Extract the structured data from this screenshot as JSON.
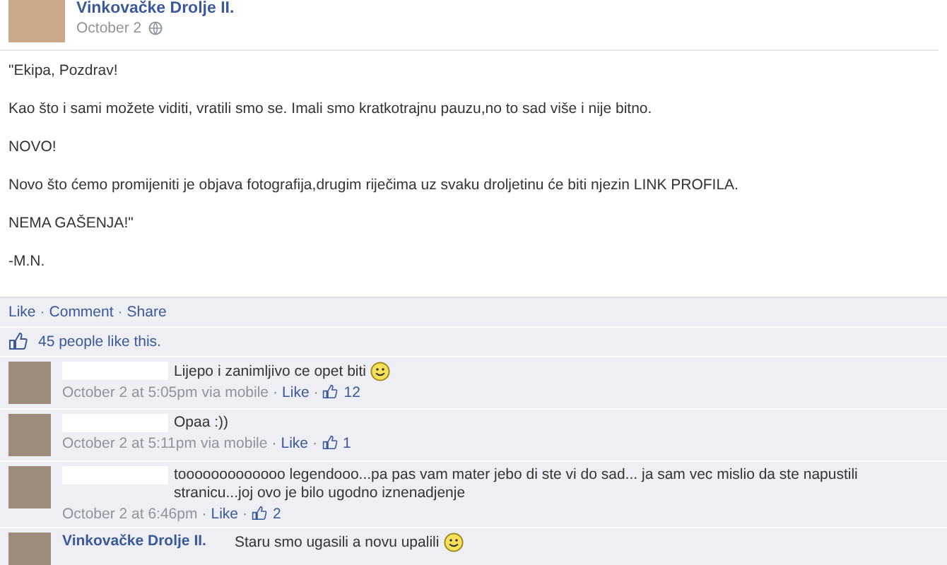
{
  "post": {
    "author": "Vinkovačke Drolje II.",
    "date": "October 2",
    "paragraphs": [
      "\"Ekipa, Pozdrav!",
      "Kao što i sami možete viditi, vratili smo se. Imali smo kratkotrajnu pauzu,no to sad više i nije bitno.",
      "NOVO!",
      "Novo što ćemo promijeniti je objava fotografija,drugim riječima uz svaku droljetinu će biti njezin LINK PROFILA.",
      "NEMA GAŠENJA!\"",
      "-M.N."
    ]
  },
  "separator": "·",
  "actions": [
    "Like",
    "Comment",
    "Share"
  ],
  "likes": "45 people like this.",
  "comments": [
    {
      "text": "Lijepo i zanimljivo ce opet biti",
      "smiley": true,
      "time": "October 2 at 5:05pm",
      "via": "via mobile",
      "like": "Like",
      "count": "12"
    },
    {
      "text": "Opaa :))",
      "smiley": false,
      "time": "October 2 at 5:11pm",
      "via": "via mobile",
      "like": "Like",
      "count": "1"
    },
    {
      "text": "tooooooooooooo legendooo...pa pas vam mater jebo di ste vi do sad... ja sam vec mislio da ste napustili stranicu...joj ovo je bilo ugodno iznenadjenje",
      "smiley": false,
      "time": "October 2 at 6:46pm",
      "like": "Like",
      "count": "2"
    },
    {
      "author": "Vinkovačke Drolje II.",
      "text": "Staru smo ugasili a novu upalili",
      "smiley": true
    }
  ]
}
